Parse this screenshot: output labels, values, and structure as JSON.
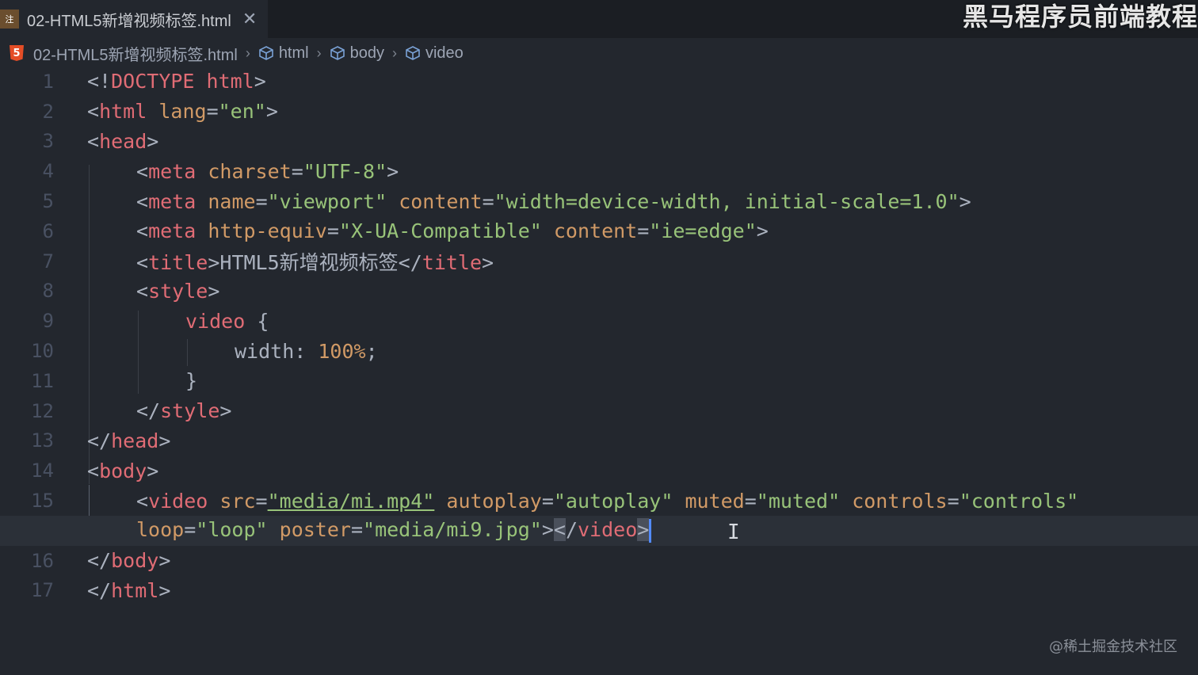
{
  "tab": {
    "icon_text": "注",
    "filename": "02-HTML5新增视频标签.html",
    "close_glyph": "✕"
  },
  "watermark_top": "黑马程序员前端教程",
  "breadcrumb": {
    "file_icon_text": "5",
    "items": [
      "02-HTML5新增视频标签.html",
      "html",
      "body",
      "video"
    ]
  },
  "editor": {
    "line_numbers": [
      "1",
      "2",
      "3",
      "4",
      "5",
      "6",
      "7",
      "8",
      "9",
      "10",
      "11",
      "12",
      "13",
      "14",
      "15",
      "",
      "16",
      "17"
    ],
    "lines": [
      {
        "ln": "1",
        "seg": [
          "<!DOCTYPE html>"
        ]
      },
      {
        "ln": "2"
      },
      {
        "ln": "3"
      }
    ]
  },
  "code": {
    "l1": {
      "open": "<!",
      "tag": "DOCTYPE html",
      "close": ">"
    },
    "l2": {
      "open": "<",
      "tag": "html",
      "attr": "lang",
      "eq": "=",
      "val": "\"en\"",
      "close": ">"
    },
    "l3": {
      "open": "<",
      "tag": "head",
      "close": ">"
    },
    "l4": {
      "open": "<",
      "tag": "meta",
      "attr": "charset",
      "eq": "=",
      "val": "\"UTF-8\"",
      "close": ">"
    },
    "l5": {
      "open": "<",
      "tag": "meta",
      "attr1": "name",
      "val1": "\"viewport\"",
      "attr2": "content",
      "val2": "\"width=device-width, initial-scale=1.0\"",
      "close": ">"
    },
    "l6": {
      "open": "<",
      "tag": "meta",
      "attr1": "http-equiv",
      "val1": "\"X-UA-Compatible\"",
      "attr2": "content",
      "val2": "\"ie=edge\"",
      "close": ">"
    },
    "l7": {
      "open": "<",
      "tag": "title",
      "mid": ">",
      "text": "HTML5新增视频标签",
      "open2": "</",
      "tag2": "title",
      "close": ">"
    },
    "l8": {
      "open": "<",
      "tag": "style",
      "close": ">"
    },
    "l9": {
      "sel": "video",
      "brace": " {"
    },
    "l10": {
      "prop": "width",
      "colon": ": ",
      "num": "100%",
      "semi": ";"
    },
    "l11": {
      "brace": "}"
    },
    "l12": {
      "open": "</",
      "tag": "style",
      "close": ">"
    },
    "l13": {
      "open": "</",
      "tag": "head",
      "close": ">"
    },
    "l14": {
      "open": "<",
      "tag": "body",
      "close": ">"
    },
    "l15": {
      "open": "<",
      "tag": "video",
      "a1": "src",
      "v1": "\"media/mi.mp4\"",
      "a2": "autoplay",
      "v2": "\"autoplay\"",
      "a3": "muted",
      "v3": "\"muted\"",
      "a4": "controls",
      "v4": "\"controls\""
    },
    "l15b": {
      "a5": "loop",
      "v5": "\"loop\"",
      "a6": "poster",
      "v6": "\"media/mi9.jpg\"",
      "mid": ">",
      "lt": "<",
      "end_open": "/",
      "tag2": "video",
      "close": ">"
    },
    "l16": {
      "open": "</",
      "tag": "body",
      "close": ">"
    },
    "l17": {
      "open": "</",
      "tag": "html",
      "close": ">"
    },
    "eq": "=",
    "sp": " "
  },
  "watermark_bottom": "@稀土掘金技术社区"
}
